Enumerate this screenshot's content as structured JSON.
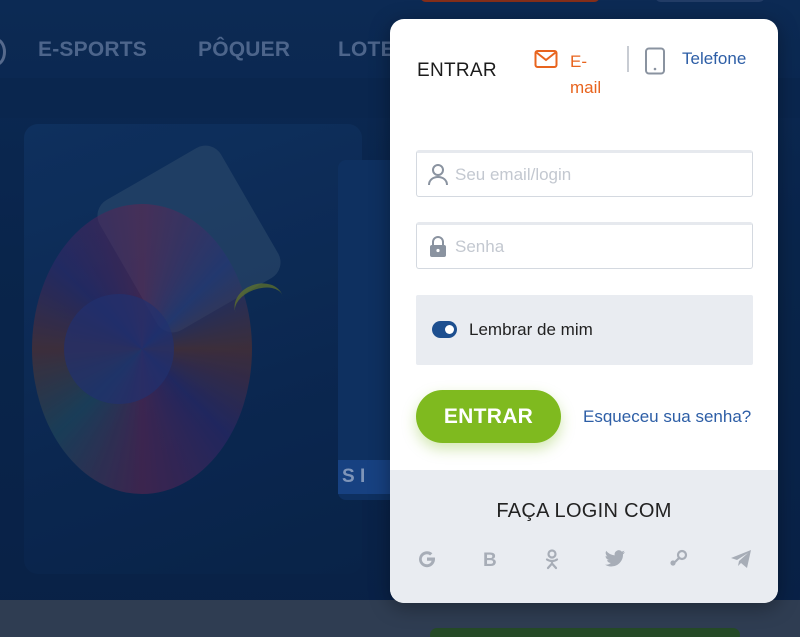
{
  "background": {
    "nav_items": [
      "E-SPORTS",
      "PÔQUER",
      "LOTE"
    ],
    "banner_strip_text": "S I"
  },
  "login": {
    "title": "ENTRAR",
    "tabs": [
      {
        "label": "E-mail",
        "icon": "mail-icon",
        "color": "#e8641e",
        "active": true
      },
      {
        "label": "Telefone",
        "icon": "phone-icon",
        "color": "#2d5ea6",
        "active": false
      }
    ],
    "email_field": {
      "placeholder": "Seu email/login",
      "value": ""
    },
    "password_field": {
      "placeholder": "Senha",
      "value": ""
    },
    "remember": {
      "label": "Lembrar de mim",
      "checked": true
    },
    "submit_label": "ENTRAR",
    "forgot_label": "Esqueceu sua senha?",
    "social": {
      "title": "FAÇA LOGIN COM",
      "providers": [
        "google-icon",
        "b-icon",
        "odnoklassniki-icon",
        "twitter-icon",
        "steam-icon",
        "telegram-icon"
      ]
    }
  },
  "colors": {
    "accent_green": "#7fba1f",
    "link_blue": "#2d5ea6",
    "email_orange": "#e8641e",
    "toggle_blue": "#1d4f8f"
  }
}
